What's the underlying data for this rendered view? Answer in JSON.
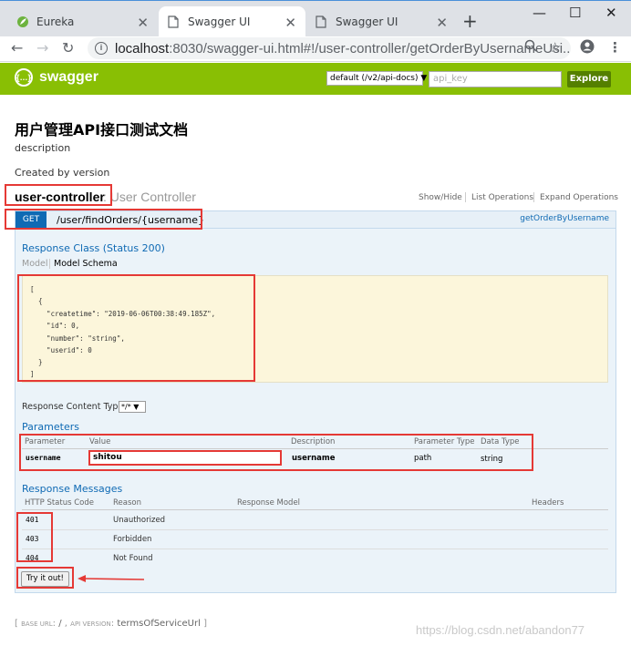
{
  "browser": {
    "tabs": [
      {
        "title": "Eureka",
        "active": false
      },
      {
        "title": "Swagger UI",
        "active": true
      },
      {
        "title": "Swagger UI",
        "active": false
      }
    ],
    "new_tab": "+",
    "window_controls": {
      "minimize": "—",
      "maximize": "☐",
      "close": "✕"
    },
    "url_host": "localhost",
    "url_rest": ":8030/swagger-ui.html#!/user-controller/getOrderByUsernameUsi..."
  },
  "swagger": {
    "brand": "swagger",
    "spec_select": "default (/v2/api-docs)",
    "api_key_placeholder": "api_key",
    "explore_label": "Explore"
  },
  "info": {
    "title": "用户管理API接口测试文档",
    "description": "description",
    "created_by": "Created by version"
  },
  "resource": {
    "name": "user-controller",
    "description": ": User Controller",
    "show_hide": "Show/Hide",
    "list_operations": "List Operations",
    "expand_operations": "Expand Operations"
  },
  "operation": {
    "method": "GET",
    "path": "/user/findOrders/{username}",
    "nickname": "getOrderByUsername",
    "response_class_title": "Response Class (Status 200)",
    "tab_model": "Model",
    "tab_model_schema": "Model Schema",
    "schema_lines": [
      "[",
      "  {",
      "    \"createtime\": \"2019-06-06T00:38:49.185Z\",",
      "    \"id\": 0,",
      "    \"number\": \"string\",",
      "    \"userid\": 0",
      "  }",
      "]"
    ],
    "response_content_type_label": "Response Content Type",
    "response_content_type": "*/*",
    "parameters_title": "Parameters",
    "param_headers": [
      "Parameter",
      "Value",
      "Description",
      "Parameter Type",
      "Data Type"
    ],
    "param": {
      "name": "username",
      "value": "shitou",
      "description": "username",
      "parameter_type": "path",
      "data_type": "string"
    },
    "response_messages_title": "Response Messages",
    "rm_headers": [
      "HTTP Status Code",
      "Reason",
      "Response Model",
      "Headers"
    ],
    "response_messages": [
      {
        "code": "401",
        "reason": "Unauthorized"
      },
      {
        "code": "403",
        "reason": "Forbidden"
      },
      {
        "code": "404",
        "reason": "Not Found"
      }
    ],
    "try_it_out": "Try it out!"
  },
  "footer": {
    "base_url_label": "BASE URL",
    "base_url_value": "/",
    "api_version_label": "API VERSION",
    "api_version_value": "termsOfServiceUrl"
  },
  "watermark": "https://blog.csdn.net/abandon77",
  "colors": {
    "swagger_green": "#89bf04",
    "get_blue": "#0f6ab4",
    "annotation_red": "#e53935"
  }
}
